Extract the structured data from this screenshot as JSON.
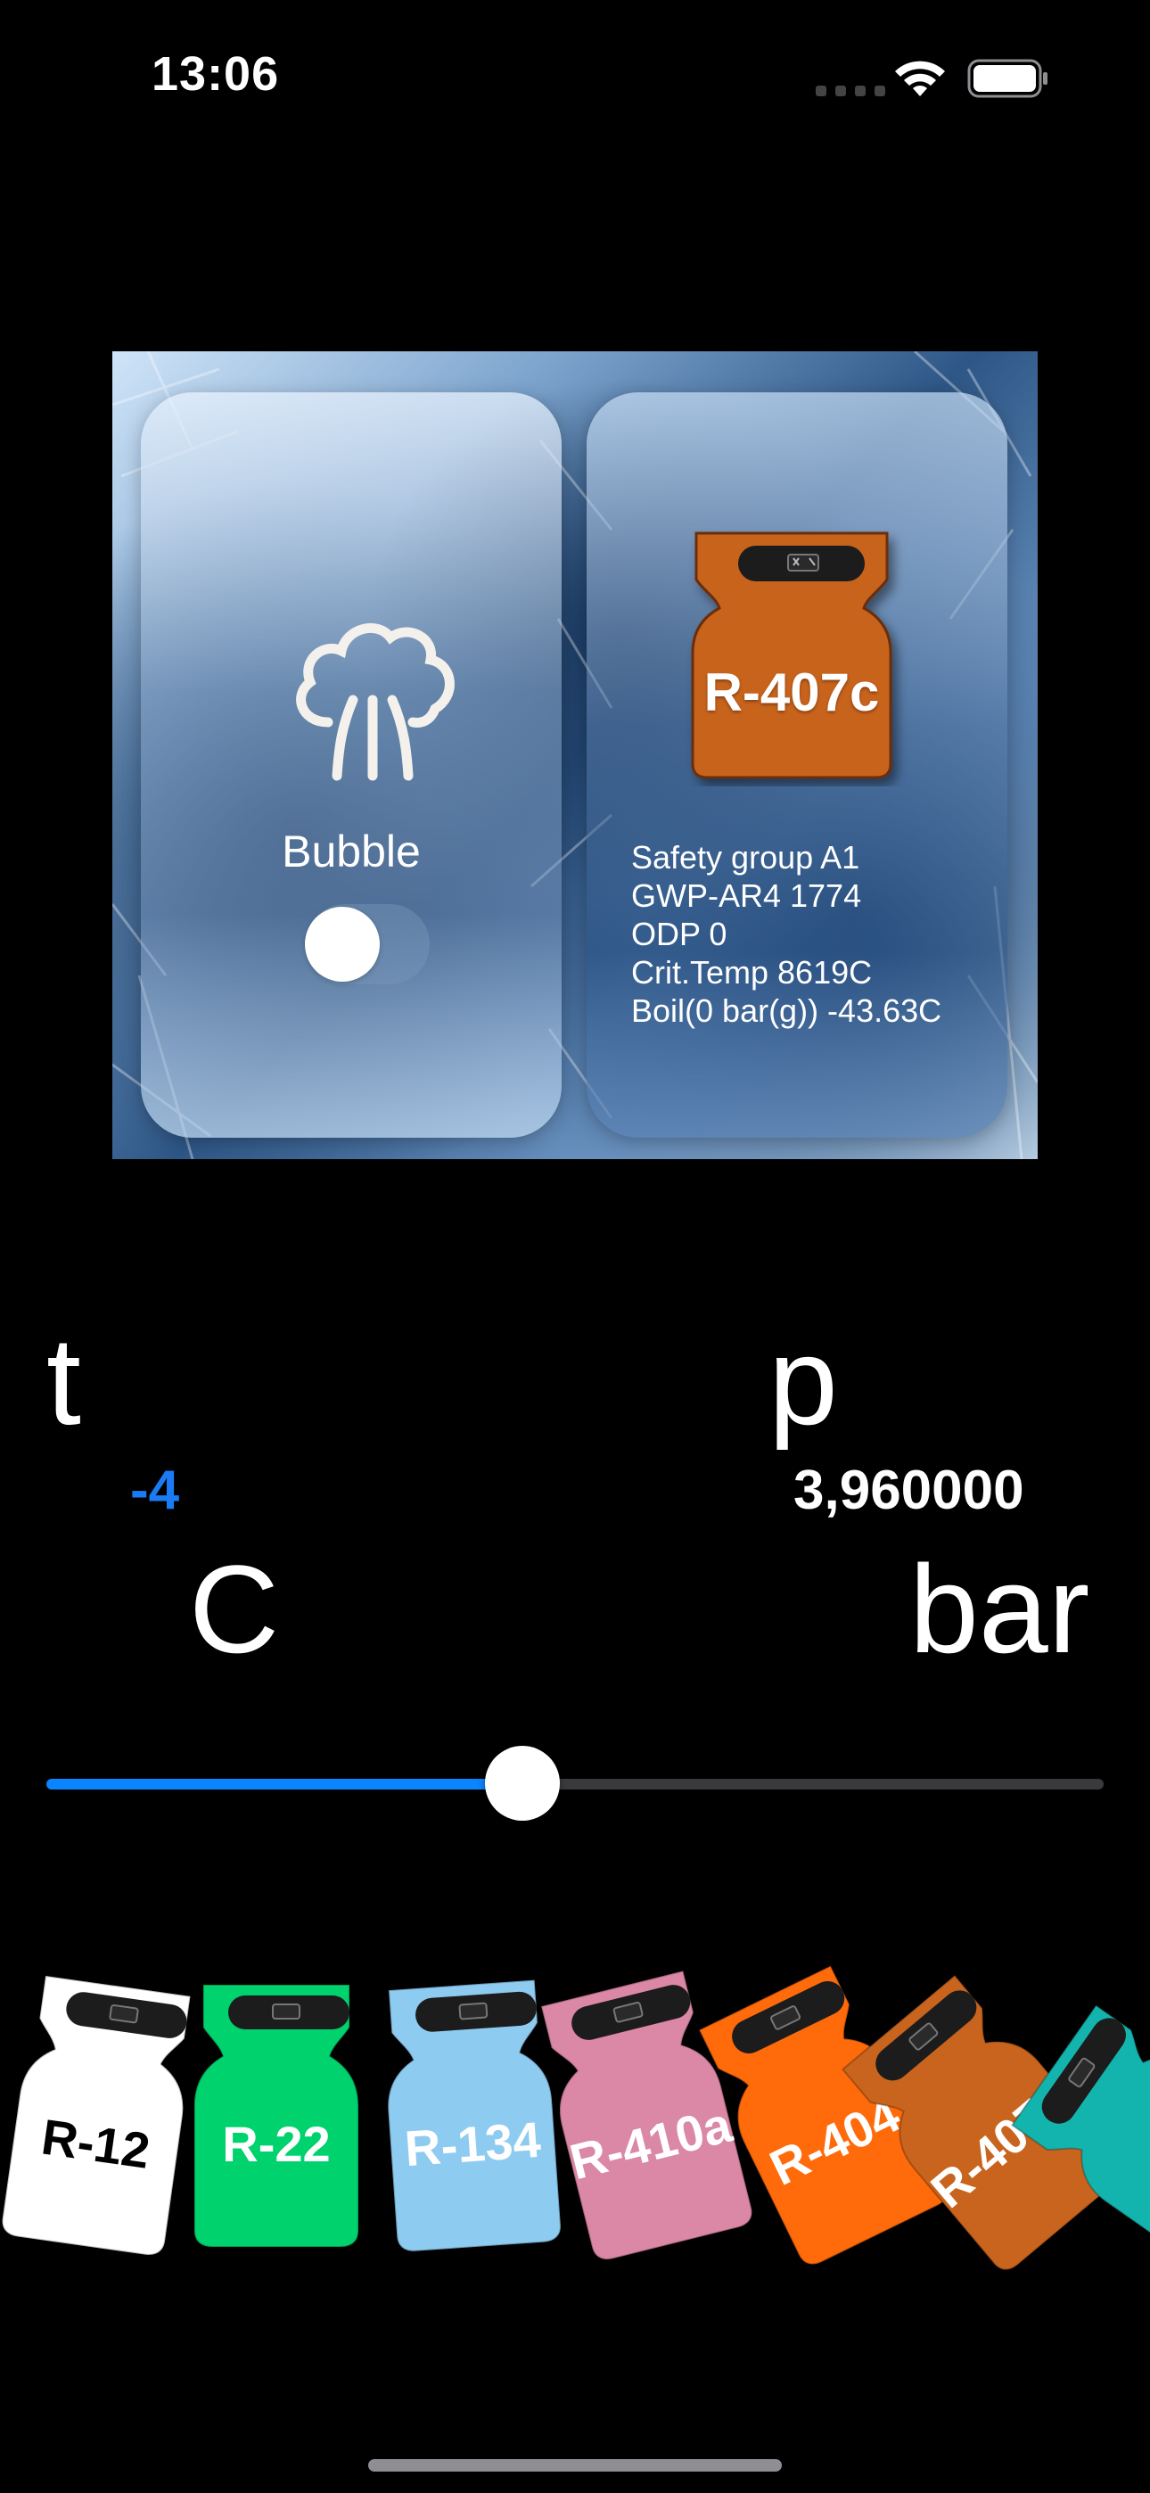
{
  "status_bar": {
    "time": "13:06"
  },
  "panel": {
    "left_card": {
      "label": "Bubble",
      "toggle_on": false
    },
    "right_card": {
      "refrigerant": "R-407c",
      "cylinder_color": "#c8641e",
      "info": [
        "Safety group A1",
        "GWP-AR4 1774",
        "ODP 0",
        "Crit.Temp 8619C",
        "Boil(0 bar(g)) -43.63C"
      ]
    }
  },
  "readouts": {
    "t_label": "t",
    "p_label": "p",
    "t_value": "-4",
    "p_value": "3,960000",
    "t_unit": "C",
    "p_unit": "bar"
  },
  "slider": {
    "fraction": 0.45,
    "fill_color": "#0a84ff"
  },
  "refrigerants": [
    {
      "name": "R-12",
      "color": "#ffffff",
      "text_color": "#000000"
    },
    {
      "name": "R-22",
      "color": "#00d26e",
      "text_color": "#ffffff"
    },
    {
      "name": "R-134",
      "color": "#8ecbf0",
      "text_color": "#ffffff"
    },
    {
      "name": "R-410a",
      "color": "#db87a6",
      "text_color": "#ffffff"
    },
    {
      "name": "R-404",
      "color": "#ff6a0a",
      "text_color": "#ffffff"
    },
    {
      "name": "R-407c",
      "color": "#c8641e",
      "text_color": "#ffffff"
    },
    {
      "name": "",
      "color": "#14b4ae",
      "text_color": "#ffffff"
    }
  ]
}
